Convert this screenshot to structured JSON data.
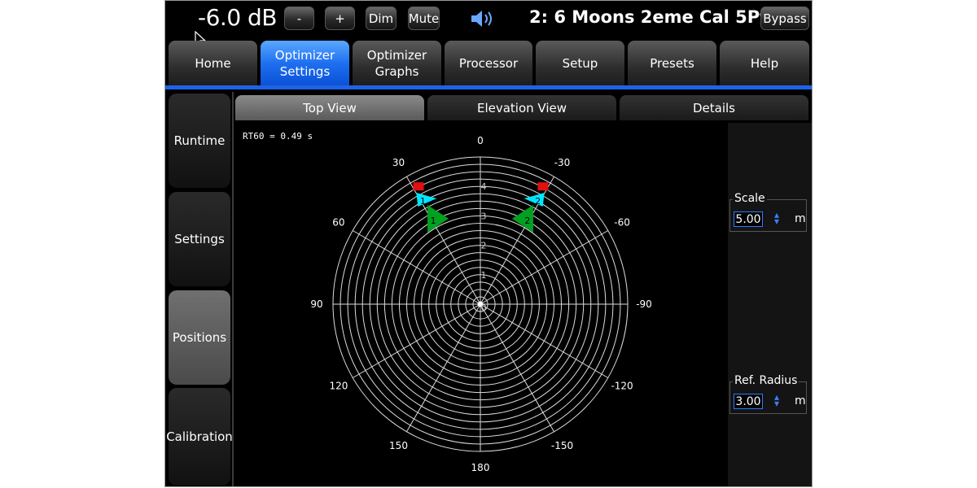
{
  "topbar": {
    "volume": "-6.0 dB",
    "minus_label": "-",
    "plus_label": "+",
    "dim_label": "Dim",
    "mute_label": "Mute",
    "preset_name": "2: 6 Moons 2eme Cal 5Pts",
    "bypass_label": "Bypass"
  },
  "main_tabs": [
    {
      "line1": "Home",
      "line2": ""
    },
    {
      "line1": "Optimizer",
      "line2": "Settings",
      "active": true
    },
    {
      "line1": "Optimizer",
      "line2": "Graphs"
    },
    {
      "line1": "Processor",
      "line2": ""
    },
    {
      "line1": "Setup",
      "line2": ""
    },
    {
      "line1": "Presets",
      "line2": ""
    },
    {
      "line1": "Help",
      "line2": ""
    }
  ],
  "side_nav": [
    "Runtime",
    "Settings",
    "Positions",
    "Calibration"
  ],
  "side_nav_active": "Positions",
  "sub_tabs": [
    "Top View",
    "Elevation View",
    "Details"
  ],
  "sub_tab_active": "Top View",
  "rt60": "RT60 = 0.49 s",
  "polar": {
    "angle_labels": [
      "0",
      "30",
      "-30",
      "60",
      "-60",
      "90",
      "-90",
      "120",
      "-120",
      "150",
      "-150",
      "180"
    ],
    "radial_labels": [
      "0",
      "1",
      "2",
      "3",
      "4"
    ],
    "speakers": [
      {
        "label": "1",
        "color": "#00e5ff",
        "r": 4.1,
        "angle": 28
      },
      {
        "label": "2",
        "color": "#00e5ff",
        "r": 4.1,
        "angle": -28
      },
      {
        "label": "1",
        "color": "#00a020",
        "r": 3.35,
        "angle": 28
      },
      {
        "label": "2",
        "color": "#00a020",
        "r": 3.35,
        "angle": -28
      }
    ],
    "markers_red": [
      {
        "r": 4.5,
        "angle": 28
      },
      {
        "r": 4.5,
        "angle": -28
      }
    ]
  },
  "scale": {
    "label": "Scale",
    "value": "5.00",
    "unit": "m"
  },
  "ref_radius": {
    "label": "Ref. Radius",
    "value": "3.00",
    "unit": "m"
  },
  "colors": {
    "accent_blue": "#1e63e6",
    "active_tab": "#1e6ff0",
    "speaker_cyan": "#00e5ff",
    "speaker_green": "#00a020",
    "marker_red": "#e01010"
  }
}
